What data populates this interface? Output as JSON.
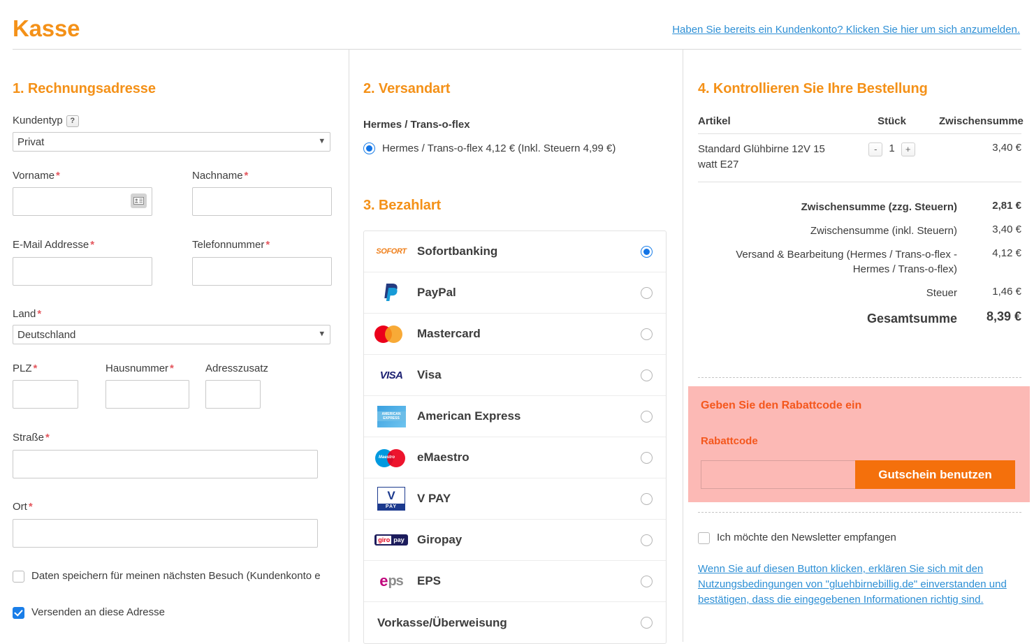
{
  "header": {
    "title": "Kasse",
    "login_link": "Haben Sie bereits ein Kundenkonto? Klicken Sie hier um sich anzumelden."
  },
  "billing": {
    "section_title": "1. Rechnungsadresse",
    "customer_type_label": "Kundentyp",
    "help_icon": "?",
    "customer_type_value": "Privat",
    "firstname_label": "Vorname",
    "firstname_value": "",
    "lastname_label": "Nachname",
    "lastname_value": "",
    "email_label": "E-Mail Addresse",
    "email_value": "",
    "phone_label": "Telefonnummer",
    "phone_value": "",
    "country_label": "Land",
    "country_value": "Deutschland",
    "zip_label": "PLZ",
    "zip_value": "",
    "housenumber_label": "Hausnummer",
    "housenumber_value": "",
    "address_extra_label": "Adresszusatz",
    "address_extra_value": "",
    "street_label": "Straße",
    "street_value": "",
    "city_label": "Ort",
    "city_value": "",
    "save_data_checkbox": "Daten speichern für meinen nächsten Besuch (Kundenkonto e",
    "save_data_checked": false,
    "ship_here_checkbox": "Versenden an diese Adresse",
    "ship_here_checked": true,
    "required_marker": "*"
  },
  "shipping": {
    "section_title": "2. Versandart",
    "carrier_name": "Hermes / Trans-o-flex",
    "option_label": "Hermes / Trans-o-flex 4,12 € (Inkl. Steuern 4,99 €)",
    "option_selected": true
  },
  "payment": {
    "section_title": "3. Bezahlart",
    "selected": "Sofortbanking",
    "methods": [
      {
        "name": "Sofortbanking",
        "logo": "sofort-logo",
        "selected": true
      },
      {
        "name": "PayPal",
        "logo": "paypal-logo",
        "selected": false
      },
      {
        "name": "Mastercard",
        "logo": "mastercard-logo",
        "selected": false
      },
      {
        "name": "Visa",
        "logo": "visa-logo",
        "selected": false
      },
      {
        "name": "American Express",
        "logo": "amex-logo",
        "selected": false
      },
      {
        "name": "eMaestro",
        "logo": "maestro-logo",
        "selected": false
      },
      {
        "name": "V PAY",
        "logo": "vpay-logo",
        "selected": false
      },
      {
        "name": "Giropay",
        "logo": "giropay-logo",
        "selected": false
      },
      {
        "name": "EPS",
        "logo": "eps-logo",
        "selected": false
      },
      {
        "name": "Vorkasse/Überweisung",
        "logo": "",
        "selected": false
      }
    ],
    "logo_text": {
      "sofort": "SOFORT",
      "visa": "VISA",
      "amex": "AMERICAN EXPRESS",
      "maestro": "Maestro",
      "vpay_v": "V",
      "vpay_pay": "PAY",
      "giro_a": "giro",
      "giro_b": "pay",
      "eps_e": "e",
      "eps_ps": "ps"
    }
  },
  "order": {
    "section_title": "4. Kontrollieren Sie Ihre Bestellung",
    "columns": {
      "item": "Artikel",
      "qty": "Stück",
      "subtotal": "Zwischensumme"
    },
    "items": [
      {
        "name": "Standard Glühbirne 12V 15 watt E27",
        "qty": "1",
        "decrement": "-",
        "increment": "+",
        "subtotal": "3,40 €"
      }
    ],
    "totals": [
      {
        "label": "Zwischensumme (zzg. Steuern)",
        "value": "2,81 €",
        "bold": true
      },
      {
        "label": "Zwischensumme (inkl. Steuern)",
        "value": "3,40 €",
        "bold": false
      },
      {
        "label": "Versand & Bearbeitung (Hermes / Trans-o-flex - Hermes / Trans-o-flex)",
        "value": "4,12 €",
        "bold": false
      },
      {
        "label": "Steuer",
        "value": "1,46 €",
        "bold": false
      }
    ],
    "grand_total_label": "Gesamtsumme",
    "grand_total_value": "8,39 €"
  },
  "discount": {
    "title": "Geben Sie den Rabattcode ein",
    "field_label": "Rabattcode",
    "input_value": "",
    "button_label": "Gutschein benutzen"
  },
  "footer": {
    "newsletter_label": "Ich möchte den Newsletter empfangen",
    "newsletter_checked": false,
    "terms_text": "Wenn Sie auf diesen Button klicken, erklären Sie sich mit den Nutzungsbedingungen von \"gluehbirnebillig.de\" einverstanden und bestätigen, dass die eingegebenen Informationen richtig sind."
  },
  "colors": {
    "brand_orange": "#f49118",
    "link_blue": "#2d8fd5",
    "required_red": "#e4575e",
    "discount_bg": "#fcb9b5",
    "discount_button": "#f4700c",
    "radio_blue": "#1274e6",
    "checkbox_blue": "#1a7ee8"
  }
}
